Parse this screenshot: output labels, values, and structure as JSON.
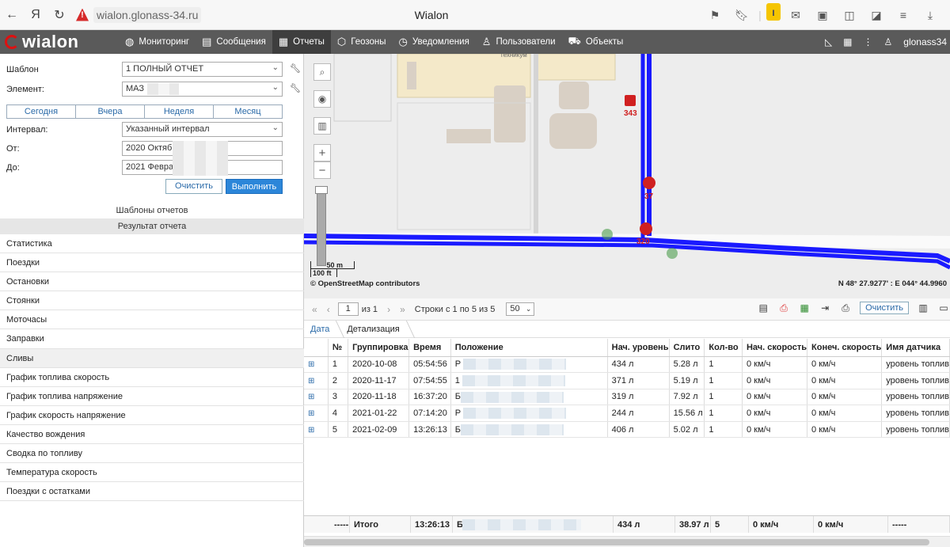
{
  "browser": {
    "title": "Wialon",
    "url": "wialon.glonass-34.ru",
    "warning_icon": "!",
    "yandex_letter": "Я"
  },
  "app": {
    "logo": "wialon",
    "nav": [
      {
        "label": "Мониторинг",
        "icon": "globe-icon"
      },
      {
        "label": "Сообщения",
        "icon": "messages-icon"
      },
      {
        "label": "Отчеты",
        "icon": "reports-icon",
        "active": true
      },
      {
        "label": "Геозоны",
        "icon": "geofence-icon"
      },
      {
        "label": "Уведомления",
        "icon": "alarm-icon"
      },
      {
        "label": "Пользователи",
        "icon": "user-icon"
      },
      {
        "label": "Объекты",
        "icon": "truck-icon"
      }
    ],
    "username": "glonass34"
  },
  "form": {
    "template_label": "Шаблон",
    "template_value": "1 ПОЛНЫЙ ОТЧЕТ",
    "element_label": "Элемент:",
    "element_value": "МАЗ",
    "periods": [
      "Сегодня",
      "Вчера",
      "Неделя",
      "Месяц"
    ],
    "interval_label": "Интервал:",
    "interval_value": "Указанный интервал",
    "from_label": "От:",
    "from_value": "2020 Октябр",
    "to_label": "До:",
    "to_value": "2021 Февра",
    "clear_button": "Очистить",
    "run_button": "Выполнить"
  },
  "templates_title": "Шаблоны отчетов",
  "result_title": "Результат отчета",
  "report_items": [
    "Статистика",
    "Поездки",
    "Остановки",
    "Стоянки",
    "Моточасы",
    "Заправки",
    "Сливы",
    "График топлива скорость",
    "График топлива напряжение",
    "График скорость напряжение",
    "Качество вождения",
    "Сводка по топливу",
    "Температура скорость",
    "Поездки с остатками"
  ],
  "selected_report": "Сливы",
  "map": {
    "attribution": "© OpenStreetMap contributors",
    "coords": "N 48° 27.9277' : E 044° 44.9960",
    "scale_m": "50 m",
    "scale_ft": "100 ft",
    "markers": [
      "343",
      "37",
      "320"
    ],
    "road_label": "техникум"
  },
  "table_toolbar": {
    "page": "1",
    "of_pages": "из 1",
    "rows_text": "Строки с 1 по 5 из 5",
    "per_page": "50",
    "clear": "Очистить"
  },
  "crumbs": [
    "Дата",
    "Детализация"
  ],
  "columns": [
    "№",
    "Группировка",
    "Время",
    "Положение",
    "Нач. уровень",
    "Слито",
    "Кол-во",
    "Нач. скорость",
    "Конеч. скорость",
    "Имя датчика"
  ],
  "rows": [
    {
      "n": "1",
      "group": "2020-10-08",
      "time": "05:54:56",
      "pos": "Р",
      "start": "434 л",
      "drained": "5.28 л",
      "count": "1",
      "vs": "0 км/ч",
      "ve": "0 км/ч",
      "sensor": "уровень топлив"
    },
    {
      "n": "2",
      "group": "2020-11-17",
      "time": "07:54:55",
      "pos": "1",
      "start": "371 л",
      "drained": "5.19 л",
      "count": "1",
      "vs": "0 км/ч",
      "ve": "0 км/ч",
      "sensor": "уровень топлив"
    },
    {
      "n": "3",
      "group": "2020-11-18",
      "time": "16:37:20",
      "pos": "Б                                   Ж",
      "start": "319 л",
      "drained": "7.92 л",
      "count": "1",
      "vs": "0 км/ч",
      "ve": "0 км/ч",
      "sensor": "уровень топлив"
    },
    {
      "n": "4",
      "group": "2021-01-22",
      "time": "07:14:20",
      "pos": "Р",
      "start": "244 л",
      "drained": "15.56 л",
      "count": "1",
      "vs": "0 км/ч",
      "ve": "0 км/ч",
      "sensor": "уровень топлив"
    },
    {
      "n": "5",
      "group": "2021-02-09",
      "time": "13:26:13",
      "pos": "Б                                  57/3",
      "start": "406 л",
      "drained": "5.02 л",
      "count": "1",
      "vs": "0 км/ч",
      "ve": "0 км/ч",
      "sensor": "уровень топлив"
    }
  ],
  "total": {
    "n": "-----",
    "label": "Итого",
    "time": "13:26:13",
    "pos": "Б                                   , 57/3",
    "start": "434 л",
    "drained": "38.97 л",
    "count": "5",
    "vs": "0 км/ч",
    "ve": "0 км/ч",
    "sensor": "-----"
  }
}
